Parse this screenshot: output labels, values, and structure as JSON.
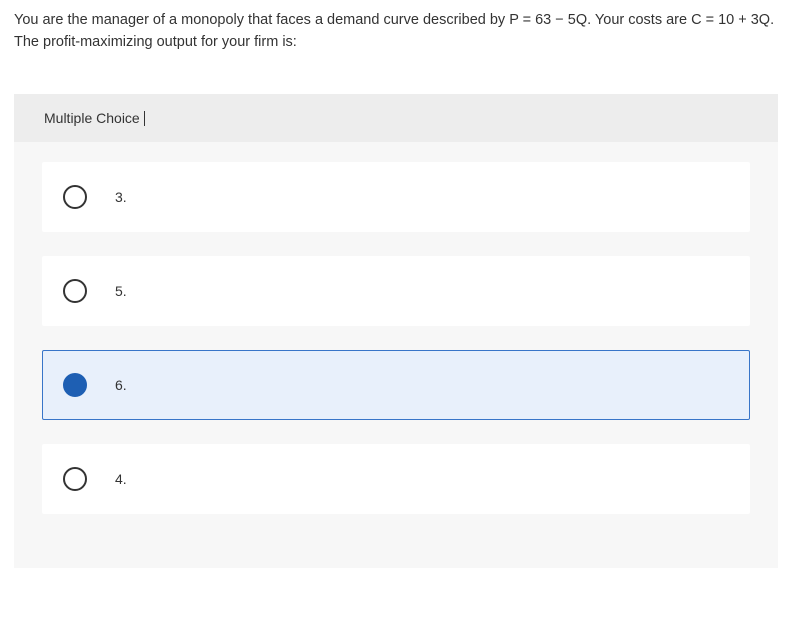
{
  "question": "You are the manager of a monopoly that faces a demand curve described by P = 63 − 5Q. Your costs are C = 10 + 3Q. The profit-maximizing output for your firm is:",
  "section_label": "Multiple Choice",
  "options": [
    {
      "label": "3.",
      "selected": false
    },
    {
      "label": "5.",
      "selected": false
    },
    {
      "label": "6.",
      "selected": true
    },
    {
      "label": "4.",
      "selected": false
    }
  ]
}
